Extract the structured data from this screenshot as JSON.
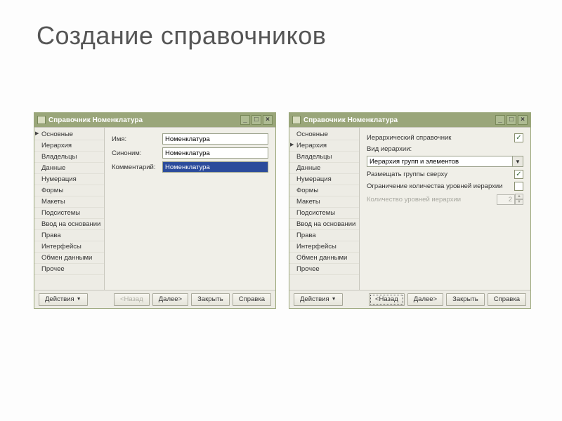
{
  "page_title": "Создание справочников",
  "sidebar_items": [
    "Основные",
    "Иерархия",
    "Владельцы",
    "Данные",
    "Нумерация",
    "Формы",
    "Макеты",
    "Подсистемы",
    "Ввод на основании",
    "Права",
    "Интерфейсы",
    "Обмен данными",
    "Прочее"
  ],
  "win1": {
    "title": "Справочник Номенклатура",
    "active_idx": 0,
    "form": {
      "name_label": "Имя:",
      "name_value": "Номенклатура",
      "syn_label": "Синоним:",
      "syn_value": "Номенклатура",
      "comment_label": "Комментарий:",
      "comment_value": "Номенклатура"
    },
    "footer": {
      "actions": "Действия",
      "back": "<Назад",
      "next": "Далее>",
      "close": "Закрыть",
      "help": "Справка"
    }
  },
  "win2": {
    "title": "Справочник Номенклатура",
    "active_idx": 1,
    "props": {
      "hier_dir": "Иерархический справочник",
      "hier_dir_checked": true,
      "view_label": "Вид иерархии:",
      "view_value": "Иерархия групп и элементов",
      "groups_top": "Размещать группы сверху",
      "groups_top_checked": true,
      "limit_levels": "Ограничение количества уровней иерархии",
      "limit_levels_checked": false,
      "levels_count": "Количество уровней иерархии",
      "levels_value": "2"
    },
    "footer": {
      "actions": "Действия",
      "back": "<Назад",
      "next": "Далее>",
      "close": "Закрыть",
      "help": "Справка"
    }
  }
}
